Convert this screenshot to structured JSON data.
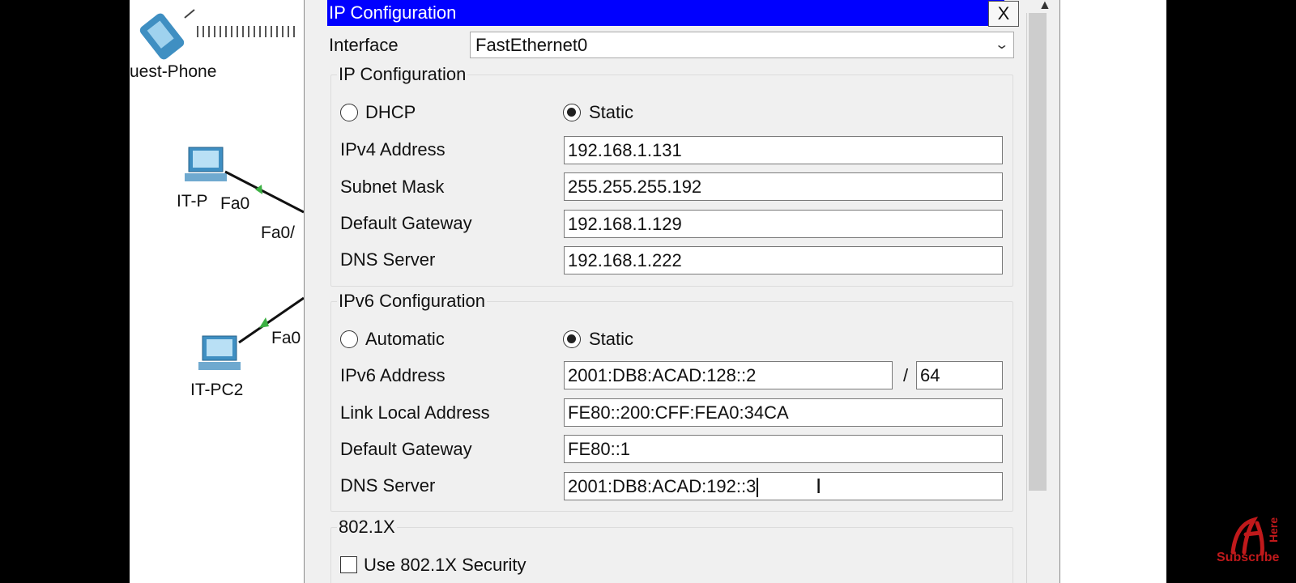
{
  "background": {
    "devices": [
      {
        "label": "uest-Phone"
      },
      {
        "label": "IT-P"
      },
      {
        "label": "IT-PC2"
      }
    ],
    "port_labels": [
      "Fa0",
      "Fa0/",
      "Fa0"
    ]
  },
  "dialog": {
    "title": "IP Configuration",
    "close_label": "X",
    "interface": {
      "label": "Interface",
      "value": "FastEthernet0"
    },
    "ipv4": {
      "group_title": "IP Configuration",
      "dhcp_label": "DHCP",
      "static_label": "Static",
      "mode": "Static",
      "address": {
        "label": "IPv4 Address",
        "value": "192.168.1.131"
      },
      "subnet": {
        "label": "Subnet Mask",
        "value": "255.255.255.192"
      },
      "gateway": {
        "label": "Default Gateway",
        "value": "192.168.1.129"
      },
      "dns": {
        "label": "DNS Server",
        "value": "192.168.1.222"
      }
    },
    "ipv6": {
      "group_title": "IPv6 Configuration",
      "auto_label": "Automatic",
      "static_label": "Static",
      "mode": "Static",
      "address": {
        "label": "IPv6 Address",
        "value": "2001:DB8:ACAD:128::2",
        "separator": "/",
        "prefix": "64"
      },
      "link_local": {
        "label": "Link Local Address",
        "value": "FE80::200:CFF:FEA0:34CA"
      },
      "gateway": {
        "label": "Default Gateway",
        "value": "FE80::1"
      },
      "dns": {
        "label": "DNS Server",
        "value": "2001:DB8:ACAD:192::3"
      }
    },
    "dot1x": {
      "group_title": "802.1X",
      "checkbox_label": "Use 802.1X Security",
      "checked": false
    }
  },
  "watermark": {
    "text1": "Subscribe",
    "text2": "Here"
  },
  "colors": {
    "titlebar": "#0000ff",
    "dialog_bg": "#f0f0f0",
    "watermark": "#c0191b"
  }
}
